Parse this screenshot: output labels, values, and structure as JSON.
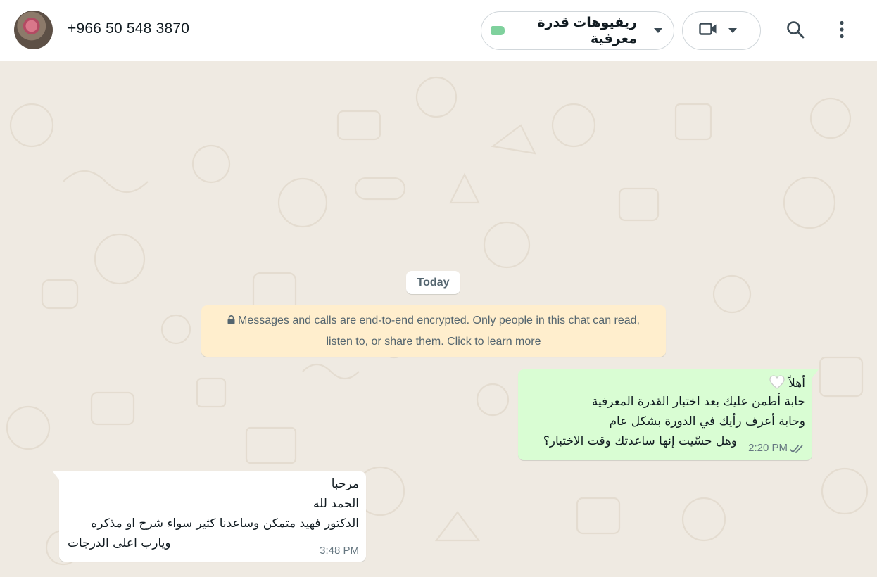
{
  "header": {
    "contact_name": "+966 50 548 3870",
    "label_name": "ريفيوهات قدرة معرفية",
    "label_color": "#7fd19d"
  },
  "chat": {
    "date_chip": "Today",
    "encryption_notice_line1": "Messages and calls are end-to-end encrypted. Only people in this chat can read,",
    "encryption_notice_line2": "listen to, or share them. Click to learn more",
    "messages": [
      {
        "direction": "outgoing",
        "lines": [
          "أهلاً",
          "حابة أطمن عليك بعد اختبار القدرة المعرفية",
          "وحابة أعرف رأيك في الدورة بشكل عام",
          "وهل حسّيت إنها ساعدتك وقت الاختبار؟"
        ],
        "time": "2:20 PM",
        "status_icon": "double-check-icon"
      },
      {
        "direction": "incoming",
        "lines": [
          "مرحبا",
          "الحمد لله",
          "الدكتور فهيد متمكن وساعدنا كثير سواء شرح او مذكره",
          "ويارب اعلى الدرجات"
        ],
        "time": "3:48 PM"
      }
    ]
  },
  "colors": {
    "outgoing_bubble": "#d9fdd3",
    "incoming_bubble": "#ffffff",
    "chat_background": "#efeae2",
    "notice_background": "#ffeecd"
  }
}
